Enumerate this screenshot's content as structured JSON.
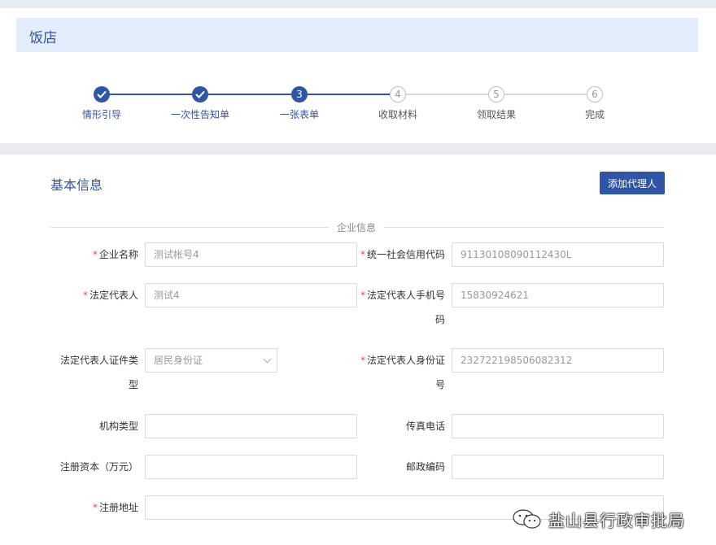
{
  "page_title": "饭店",
  "steps": [
    {
      "index": "1",
      "label": "情形引导",
      "state": "done"
    },
    {
      "index": "2",
      "label": "一次性告知单",
      "state": "done"
    },
    {
      "index": "3",
      "label": "一张表单",
      "state": "active"
    },
    {
      "index": "4",
      "label": "收取材料",
      "state": "todo"
    },
    {
      "index": "5",
      "label": "领取结果",
      "state": "todo"
    },
    {
      "index": "6",
      "label": "完成",
      "state": "todo"
    }
  ],
  "section": {
    "title": "基本信息",
    "add_agent_label": "添加代理人",
    "divider_label": "企业信息"
  },
  "form": {
    "company_name": {
      "label": "企业名称",
      "required": true,
      "value": "测试帐号4"
    },
    "credit_code": {
      "label": "统一社会信用代码",
      "required": true,
      "value": "91130108090112430L"
    },
    "legal_rep": {
      "label": "法定代表人",
      "required": true,
      "value": "测试4"
    },
    "legal_rep_phone": {
      "label_line1": "法定代表人手机号",
      "label_line2": "码",
      "required": true,
      "value": "15830924621"
    },
    "legal_rep_id_type": {
      "label_line1": "法定代表人证件类",
      "label_line2": "型",
      "required": false,
      "value": "居民身份证"
    },
    "legal_rep_id": {
      "label_line1": "法定代表人身份证",
      "label_line2": "号",
      "required": true,
      "value": "232722198506082312"
    },
    "org_type": {
      "label": "机构类型",
      "required": false,
      "value": ""
    },
    "fax": {
      "label": "传真电话",
      "required": false,
      "value": ""
    },
    "reg_capital": {
      "label": "注册资本（万元）",
      "required": false,
      "value": ""
    },
    "postal_code": {
      "label": "邮政编码",
      "required": false,
      "value": ""
    },
    "reg_address": {
      "label": "注册地址",
      "required": true,
      "value": ""
    }
  },
  "required_mark": "*",
  "watermark": {
    "text": "盐山县行政审批局",
    "icon": "wechat-icon"
  },
  "colors": {
    "accent": "#2f55a4",
    "required": "#e74c3c",
    "title_bg": "#e4edfb"
  }
}
